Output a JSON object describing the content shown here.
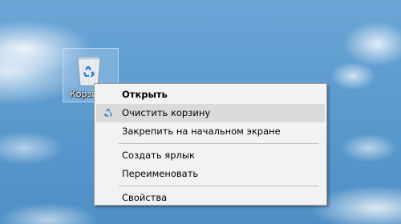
{
  "desktop": {
    "icon_label": "Корзина"
  },
  "context_menu": {
    "items": [
      {
        "label": "Открыть",
        "bold": true
      },
      {
        "label": "Очистить корзину",
        "icon": "recycle-icon",
        "highlighted": true
      },
      {
        "label": "Закрепить на начальном экране"
      },
      {
        "label": "Создать ярлык"
      },
      {
        "label": "Переименовать"
      },
      {
        "label": "Свойства"
      }
    ]
  }
}
